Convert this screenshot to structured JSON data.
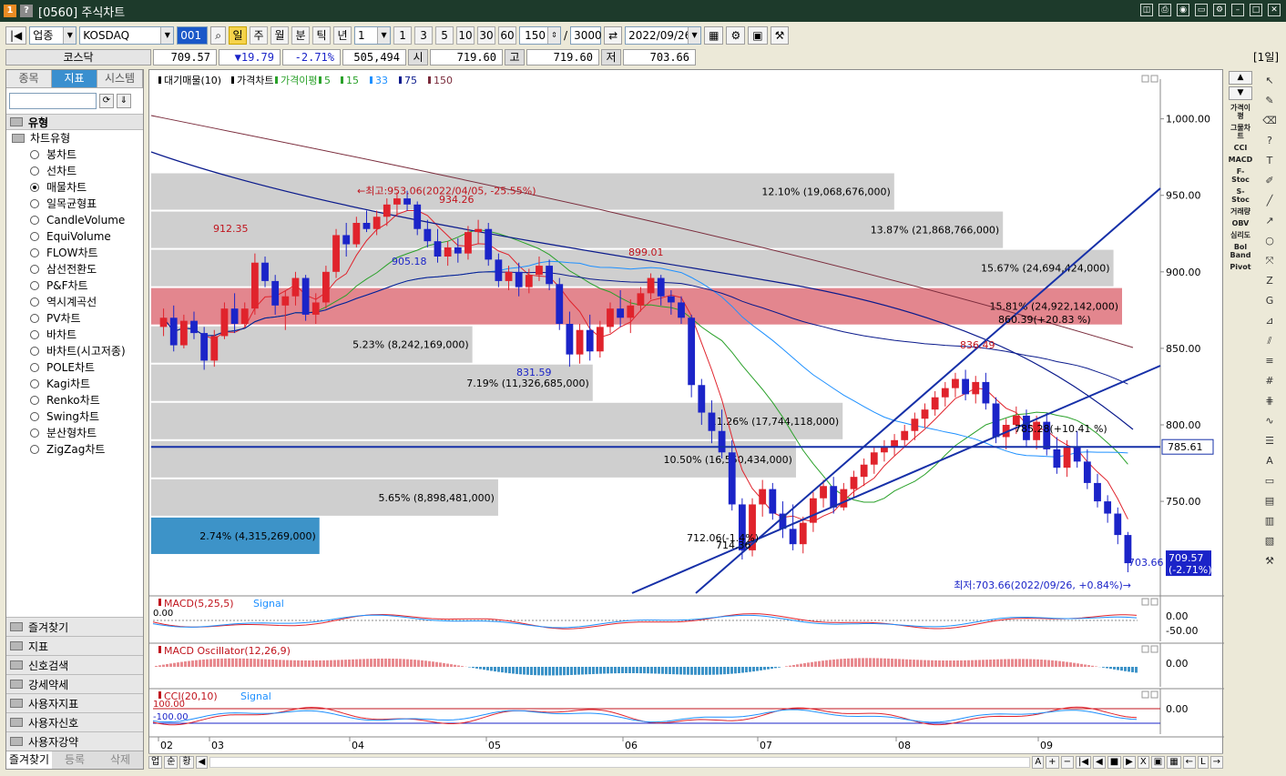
{
  "window": {
    "title": "[0560] 주식차트",
    "icons": [
      "restore-icon",
      "print-icon",
      "camera-icon",
      "minimize-icon",
      "gear-icon",
      "min-icon",
      "max-icon",
      "close-icon"
    ]
  },
  "toolbar": {
    "market_type": "업종",
    "market_name": "KOSDAQ",
    "code": "001",
    "periods": [
      "일",
      "주",
      "월",
      "분",
      "틱",
      "년"
    ],
    "count_select": "1",
    "intervals": [
      "1",
      "3",
      "5",
      "10",
      "30",
      "60"
    ],
    "view_count": "150",
    "total_count": "3000",
    "date": "2022/09/26"
  },
  "quote": {
    "name": "코스닥",
    "price": "709.57",
    "change": "▼19.79",
    "pct": "-2.71%",
    "volume": "505,494",
    "open_label": "시",
    "open": "719.60",
    "high_label": "고",
    "high": "719.60",
    "low_label": "저",
    "low": "703.66",
    "period_label": "[1일]"
  },
  "sidebar": {
    "tabs": [
      "종목",
      "지표",
      "시스템"
    ],
    "section": "유형",
    "tree_root": "차트유형",
    "items": [
      "봉차트",
      "선차트",
      "매물차트",
      "일목균형표",
      "CandleVolume",
      "EquiVolume",
      "FLOW차트",
      "삼선전환도",
      "P&F차트",
      "역시계곡선",
      "PV차트",
      "바차트",
      "바차트(시고저종)",
      "POLE차트",
      "Kagi차트",
      "Renko차트",
      "Swing차트",
      "분산형차트",
      "ZigZag차트"
    ],
    "selected": "매물차트",
    "bottom_sections": [
      "즐겨찾기",
      "지표",
      "신호검색",
      "강세약세",
      "사용자지표",
      "사용자신호",
      "사용자강약"
    ],
    "bottom_tabs": [
      "즐겨찾기",
      "등록",
      "삭제"
    ]
  },
  "legend": {
    "items": [
      "대기매물(10)",
      "가격차트",
      "가격이평",
      "5",
      "15",
      "33",
      "75",
      "150"
    ],
    "colors": [
      "#000000",
      "#000000",
      "#2aa12a",
      "#2aa12a",
      "#2aa12a",
      "#1e90ff",
      "#0a1a8c",
      "#7a2b3b"
    ]
  },
  "price_axis": {
    "ticks": [
      "1,000.00",
      "950.00",
      "900.00",
      "850.00",
      "800.00",
      "750.00"
    ],
    "hline_label": "785.61",
    "last_price": "709.57",
    "last_pct": "(-2.71%)"
  },
  "volume_profile": [
    {
      "label": "12.10% (19,068,676,000)"
    },
    {
      "label": "13.87% (21,868,766,000)"
    },
    {
      "label": "15.67% (24,694,424,000)"
    },
    {
      "label": "15.81% (24,922,142,000)"
    },
    {
      "label": "5.23% (8,242,169,000)"
    },
    {
      "label": "7.19% (11,326,685,000)"
    },
    {
      "label": "11.26% (17,744,118,000)"
    },
    {
      "label": "10.50% (16,550,434,000)"
    },
    {
      "label": "5.65% (8,898,481,000)"
    },
    {
      "label": "2.74% (4,315,269,000)"
    }
  ],
  "annotations": {
    "high": "←최고:953.06(2022/04/05, -25.55%)",
    "low": "최저:703.66(2022/09/26, +0.84%)→",
    "labels": [
      "912.35",
      "934.26",
      "905.18",
      "899.01",
      "831.59",
      "836.49",
      "860.39(+20.83 %)",
      "785.28(+10.41 %)",
      "712.06(-1.4%)",
      "714.36",
      "703.66"
    ]
  },
  "x_axis": {
    "months": [
      "02",
      "03",
      "04",
      "05",
      "06",
      "07",
      "08",
      "09"
    ]
  },
  "indicators": [
    {
      "title": "MACD(5,25,5)",
      "signal": "Signal",
      "left_value": "0.00",
      "ticks": [
        "0.00",
        "-50.00"
      ]
    },
    {
      "title": "MACD Oscillator(12,26,9)",
      "ticks": [
        "0.00"
      ]
    },
    {
      "title": "CCI(20,10)",
      "signal": "Signal",
      "left_values": [
        "100.00",
        "-100.00"
      ],
      "ticks": [
        "0.00"
      ]
    }
  ],
  "bottom_tabs": [
    "업",
    "순",
    "황"
  ],
  "right_panel": [
    "가격이평",
    "그물차트",
    "CCI",
    "MACD",
    "F-Stoc",
    "S-Stoc",
    "거래량",
    "OBV",
    "심리도",
    "Bol Band",
    "Pivot"
  ],
  "chart_data": {
    "type": "candlestick",
    "colors": {
      "up": "#e0232c",
      "down": "#1b24c8",
      "profile": "#cfcfcf",
      "profile_hi": "#e3868e",
      "profile_low": "#3d93c8"
    },
    "ylim": [
      690,
      1020
    ],
    "candles": [
      [
        864,
        876,
        858,
        870
      ],
      [
        870,
        878,
        848,
        852
      ],
      [
        852,
        872,
        850,
        868
      ],
      [
        868,
        874,
        856,
        860
      ],
      [
        860,
        864,
        836,
        842
      ],
      [
        842,
        862,
        838,
        858
      ],
      [
        858,
        880,
        856,
        876
      ],
      [
        876,
        886,
        860,
        866
      ],
      [
        866,
        880,
        864,
        876
      ],
      [
        876,
        912,
        872,
        906
      ],
      [
        906,
        910,
        890,
        894
      ],
      [
        894,
        898,
        872,
        878
      ],
      [
        878,
        888,
        862,
        884
      ],
      [
        884,
        900,
        878,
        896
      ],
      [
        896,
        898,
        868,
        872
      ],
      [
        872,
        886,
        866,
        880
      ],
      [
        880,
        904,
        876,
        900
      ],
      [
        900,
        928,
        896,
        924
      ],
      [
        924,
        932,
        910,
        918
      ],
      [
        918,
        936,
        916,
        932
      ],
      [
        932,
        940,
        926,
        928
      ],
      [
        928,
        940,
        924,
        936
      ],
      [
        936,
        948,
        930,
        944
      ],
      [
        944,
        952,
        936,
        948
      ],
      [
        948,
        953,
        940,
        944
      ],
      [
        944,
        946,
        924,
        928
      ],
      [
        928,
        934,
        916,
        920
      ],
      [
        920,
        928,
        906,
        910
      ],
      [
        910,
        920,
        904,
        916
      ],
      [
        916,
        922,
        906,
        912
      ],
      [
        912,
        930,
        908,
        926
      ],
      [
        926,
        934,
        918,
        928
      ],
      [
        928,
        932,
        904,
        908
      ],
      [
        908,
        912,
        890,
        894
      ],
      [
        894,
        904,
        888,
        900
      ],
      [
        900,
        906,
        884,
        890
      ],
      [
        890,
        902,
        886,
        898
      ],
      [
        898,
        910,
        894,
        904
      ],
      [
        904,
        908,
        888,
        892
      ],
      [
        892,
        896,
        862,
        866
      ],
      [
        866,
        874,
        838,
        846
      ],
      [
        846,
        866,
        840,
        862
      ],
      [
        862,
        872,
        842,
        848
      ],
      [
        848,
        868,
        844,
        864
      ],
      [
        864,
        880,
        860,
        876
      ],
      [
        876,
        888,
        864,
        870
      ],
      [
        870,
        882,
        860,
        878
      ],
      [
        878,
        890,
        874,
        886
      ],
      [
        886,
        899,
        882,
        896
      ],
      [
        896,
        898,
        878,
        884
      ],
      [
        884,
        888,
        872,
        880
      ],
      [
        880,
        884,
        866,
        870
      ],
      [
        870,
        872,
        818,
        826
      ],
      [
        826,
        830,
        800,
        808
      ],
      [
        808,
        816,
        788,
        796
      ],
      [
        796,
        810,
        778,
        782
      ],
      [
        782,
        790,
        744,
        748
      ],
      [
        748,
        752,
        712,
        718
      ],
      [
        718,
        752,
        714,
        748
      ],
      [
        748,
        764,
        740,
        758
      ],
      [
        758,
        762,
        738,
        742
      ],
      [
        742,
        750,
        726,
        732
      ],
      [
        732,
        748,
        718,
        722
      ],
      [
        722,
        740,
        716,
        736
      ],
      [
        736,
        756,
        730,
        752
      ],
      [
        752,
        764,
        746,
        760
      ],
      [
        760,
        766,
        742,
        746
      ],
      [
        746,
        762,
        744,
        758
      ],
      [
        758,
        770,
        752,
        766
      ],
      [
        766,
        778,
        760,
        774
      ],
      [
        774,
        786,
        768,
        782
      ],
      [
        782,
        790,
        776,
        786
      ],
      [
        786,
        794,
        780,
        790
      ],
      [
        790,
        800,
        786,
        796
      ],
      [
        796,
        808,
        790,
        804
      ],
      [
        804,
        814,
        798,
        810
      ],
      [
        810,
        822,
        806,
        818
      ],
      [
        818,
        828,
        812,
        824
      ],
      [
        824,
        834,
        818,
        830
      ],
      [
        830,
        836,
        816,
        820
      ],
      [
        820,
        832,
        814,
        828
      ],
      [
        828,
        834,
        810,
        814
      ],
      [
        814,
        818,
        788,
        792
      ],
      [
        792,
        804,
        784,
        800
      ],
      [
        800,
        812,
        794,
        806
      ],
      [
        806,
        810,
        786,
        790
      ],
      [
        790,
        806,
        784,
        802
      ],
      [
        802,
        808,
        780,
        784
      ],
      [
        784,
        792,
        768,
        772
      ],
      [
        772,
        790,
        766,
        786
      ],
      [
        786,
        796,
        772,
        776
      ],
      [
        776,
        784,
        758,
        762
      ],
      [
        762,
        768,
        746,
        750
      ],
      [
        750,
        754,
        736,
        742
      ],
      [
        742,
        746,
        722,
        728
      ],
      [
        728,
        730,
        703.66,
        709.57
      ]
    ],
    "profile_bands": [
      {
        "low": 940,
        "high": 965,
        "pct": 12.1
      },
      {
        "low": 915,
        "high": 940,
        "pct": 13.87
      },
      {
        "low": 890,
        "high": 915,
        "pct": 15.67
      },
      {
        "low": 865,
        "high": 890,
        "pct": 15.81
      },
      {
        "low": 840,
        "high": 865,
        "pct": 5.23
      },
      {
        "low": 815,
        "high": 840,
        "pct": 7.19
      },
      {
        "low": 790,
        "high": 815,
        "pct": 11.26
      },
      {
        "low": 765,
        "high": 790,
        "pct": 10.5
      },
      {
        "low": 740,
        "high": 765,
        "pct": 5.65
      },
      {
        "low": 715,
        "high": 740,
        "pct": 2.74
      }
    ],
    "hline": 785.61
  }
}
